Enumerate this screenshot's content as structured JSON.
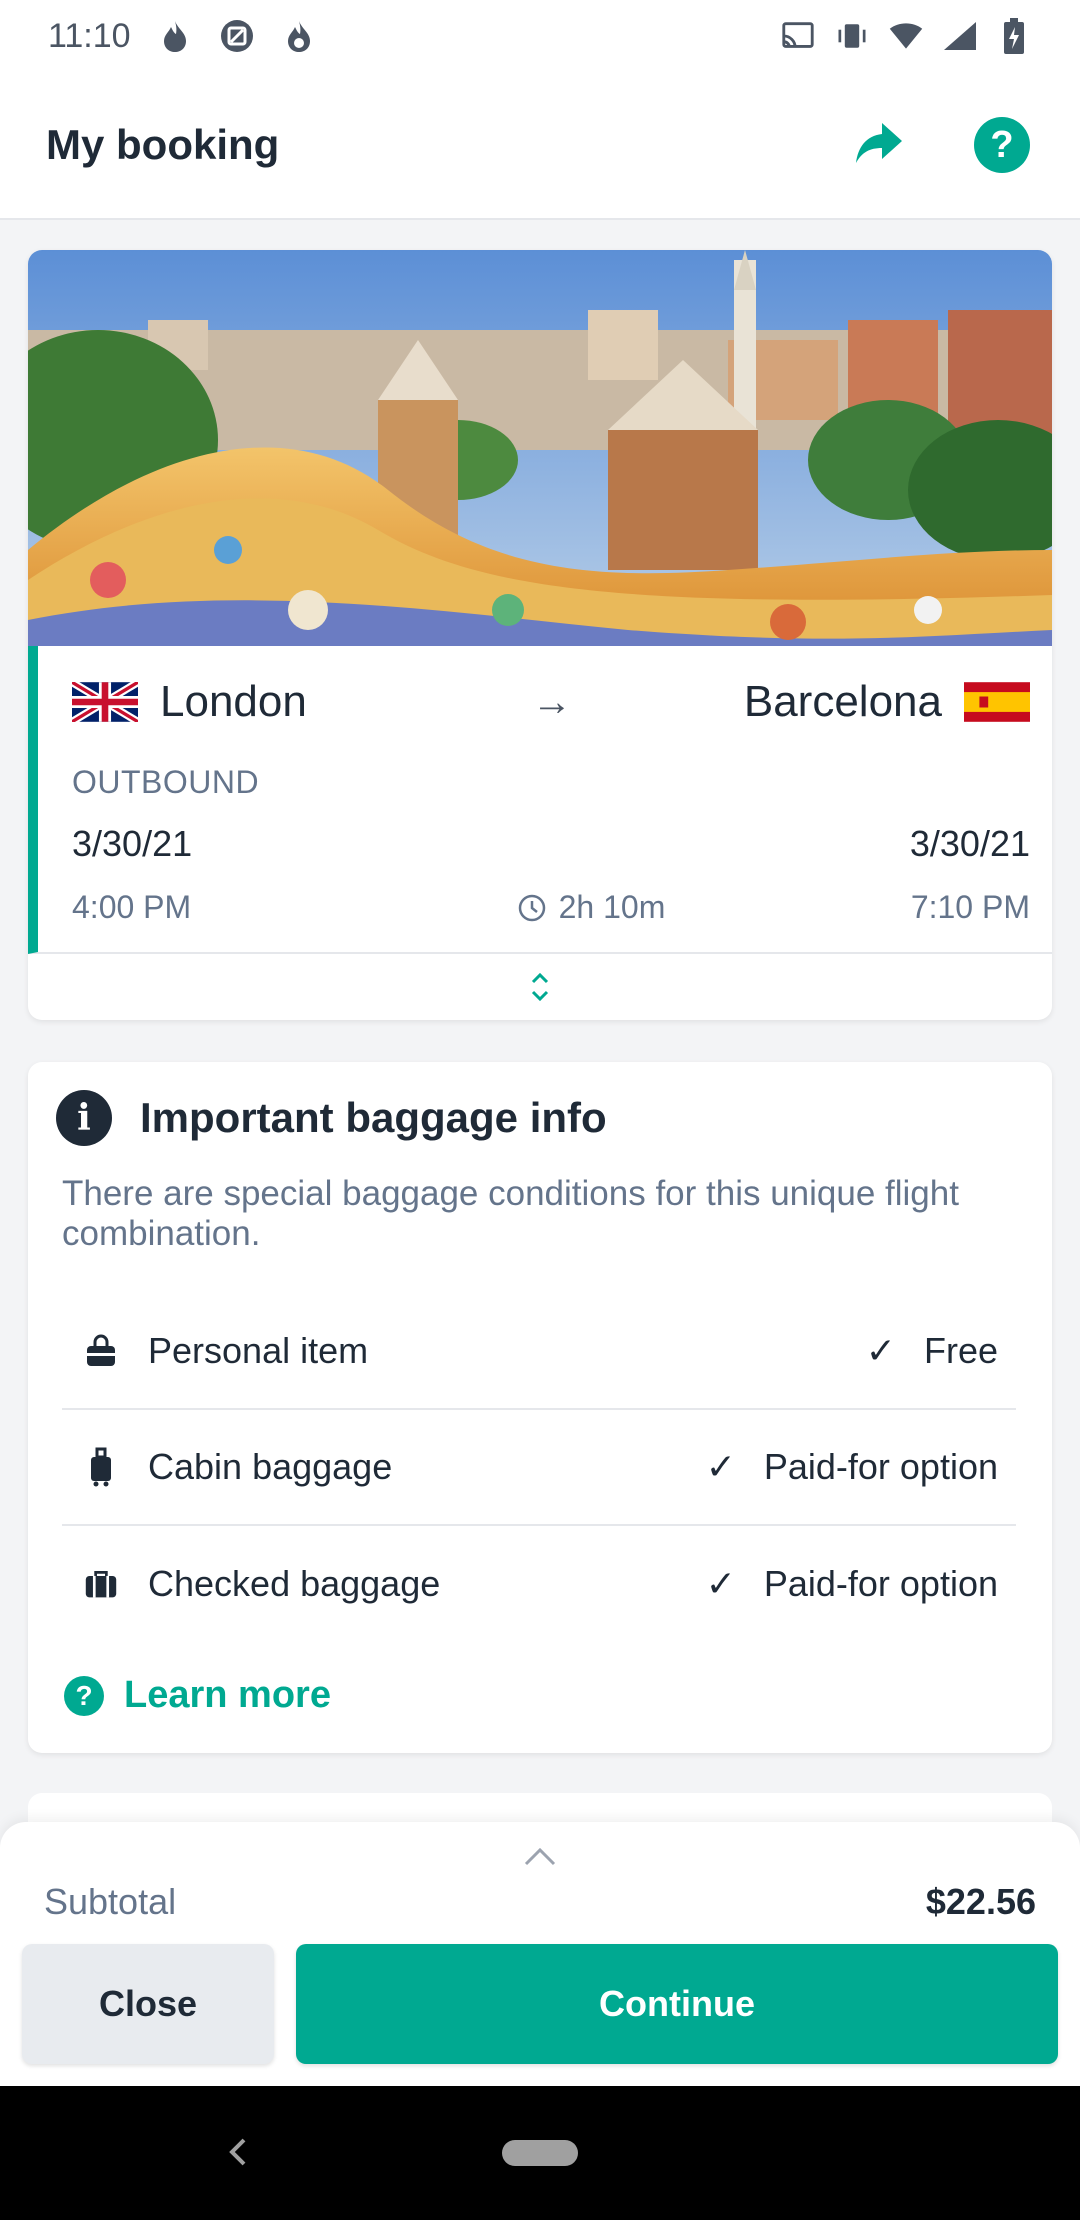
{
  "status_bar": {
    "time": "11:10",
    "left_icons": [
      "flame-icon",
      "image-icon",
      "fire-icon"
    ],
    "right_icons": [
      "cast-icon",
      "vibrate-icon",
      "wifi-icon",
      "signal-icon",
      "battery-icon"
    ]
  },
  "app_bar": {
    "title": "My booking",
    "share_icon": "share-arrow-icon",
    "help_icon": "help-icon",
    "help_glyph": "?",
    "accent": "#00a991"
  },
  "flight": {
    "origin": {
      "city": "London",
      "flag": "uk-flag"
    },
    "destination": {
      "city": "Barcelona",
      "flag": "spain-flag"
    },
    "arrow": "→",
    "direction": "OUTBOUND",
    "departure_date": "3/30/21",
    "arrival_date": "3/30/21",
    "departure_time": "4:00 PM",
    "arrival_time": "7:10 PM",
    "duration": "2h 10m"
  },
  "baggage": {
    "title": "Important baggage info",
    "info_glyph": "i",
    "description": "There are special baggage conditions for this unique flight combination.",
    "items": [
      {
        "label": "Personal item",
        "status": "Free",
        "icon": "handbag-icon"
      },
      {
        "label": "Cabin baggage",
        "status": "Paid-for option",
        "icon": "cabin-bag-icon"
      },
      {
        "label": "Checked baggage",
        "status": "Paid-for option",
        "icon": "suitcase-icon"
      }
    ],
    "check_glyph": "✓",
    "learn_more": "Learn more",
    "learn_glyph": "?"
  },
  "summary": {
    "subtotal_label": "Subtotal",
    "subtotal_value": "$22.56",
    "close_label": "Close",
    "continue_label": "Continue"
  },
  "colors": {
    "accent": "#00a991",
    "text": "#1f2a37",
    "muted": "#64748b"
  }
}
